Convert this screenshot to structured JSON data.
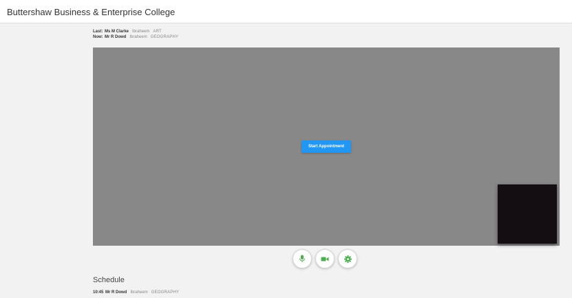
{
  "app": {
    "title": "Buttershaw Business & Enterprise College"
  },
  "session": {
    "last": {
      "label": "Last:",
      "teacher": "Ms M Clarke",
      "student": "Ibraheem",
      "subject": "ART"
    },
    "now": {
      "label": "Now:",
      "teacher": "Mr R Dowd",
      "student": "Ibraheem",
      "subject": "GEOGRAPHY"
    }
  },
  "stage": {
    "start_button_label": "Start Appointment"
  },
  "controls": {
    "accent_color": "#4caf50",
    "icons": [
      "microphone-icon",
      "video-camera-icon",
      "gear-icon"
    ]
  },
  "schedule": {
    "title": "Schedule",
    "items": [
      {
        "time": "10:45",
        "teacher": "Mr R Dowd",
        "student": "Ibraheem",
        "subject": "GEOGRAPHY"
      }
    ]
  }
}
